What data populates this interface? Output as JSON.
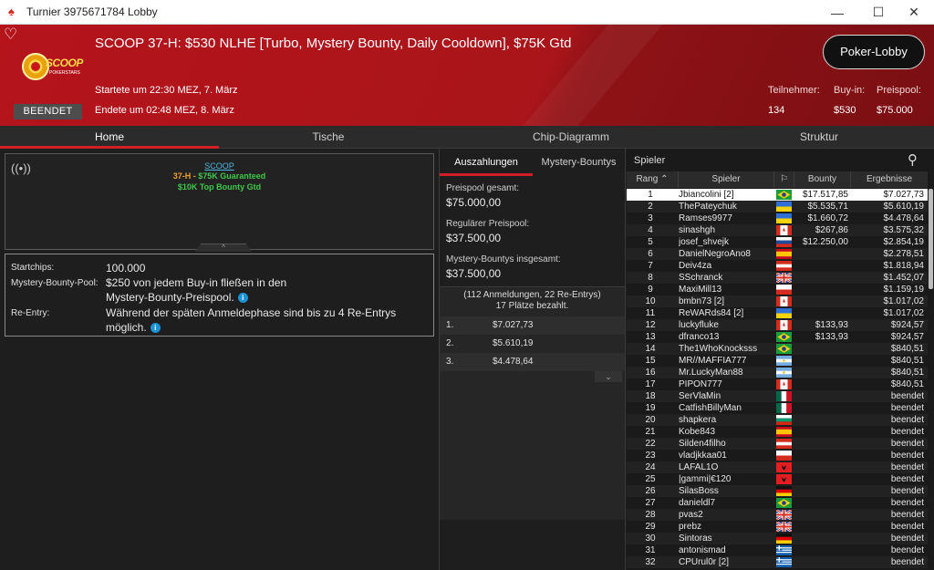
{
  "window": {
    "title": "Turnier 3975671784 Lobby",
    "minimize": "—",
    "maximize": "☐",
    "close": "✕"
  },
  "header": {
    "title": "SCOOP 37-H: $530 NLHE [Turbo, Mystery Bounty, Daily Cooldown], $75K Gtd",
    "started": "Startete um 22:30 MEZ, 7. März",
    "ended": "Endete um 02:48 MEZ, 8. März",
    "status": "BEENDET",
    "logo_text": "SCOOP",
    "logo_sub": "POKERSTARS",
    "lobby_button": "Poker-Lobby",
    "stats": [
      {
        "label": "Teilnehmer:",
        "value": "134"
      },
      {
        "label": "Buy-in:",
        "value": "$530"
      },
      {
        "label": "Preispool:",
        "value": "$75.000"
      }
    ]
  },
  "tabs": [
    "Home",
    "Tische",
    "Chip-Diagramm",
    "Struktur"
  ],
  "promo": {
    "link": "SCOOP",
    "event_code": "37-H",
    "event_sep": " - ",
    "event_text": "$75K Guaranteed",
    "bounty": "$10K Top Bounty Gtd"
  },
  "info": {
    "startchips_label": "Startchips:",
    "startchips_value": "100.000",
    "pool_label": "Mystery-Bounty-Pool:",
    "pool_value_1": "$250 von jedem Buy-in fließen in den",
    "pool_value_2": "Mystery-Bounty-Preispool.",
    "reentry_label": "Re-Entry:",
    "reentry_value_1": "Während der späten Anmeldephase sind bis zu 4 Re-Entrys",
    "reentry_value_2": "möglich."
  },
  "payouts": {
    "tabs": [
      "Auszahlungen",
      "Mystery-Bountys"
    ],
    "total_label": "Preispool gesamt:",
    "total_value": "$75.000,00",
    "regular_label": "Regulärer Preispool:",
    "regular_value": "$37.500,00",
    "bounty_label": "Mystery-Bountys insgesamt:",
    "bounty_value": "$37.500,00",
    "entries_note": "(112 Anmeldungen, 22 Re-Entrys)",
    "paid_note": "17 Plätze bezahlt.",
    "rows": [
      {
        "rank": "1.",
        "amount": "$7.027,73"
      },
      {
        "rank": "2.",
        "amount": "$5.610,19"
      },
      {
        "rank": "3.",
        "amount": "$4.478,64"
      }
    ]
  },
  "players": {
    "search_label": "Spieler",
    "columns": [
      "Rang",
      "Spieler",
      "Bounty",
      "Ergebnisse"
    ],
    "rows": [
      {
        "rank": "1",
        "name": "Jbiancolini [2]",
        "flag": "br",
        "bounty": "$17.517,85",
        "result": "$7.027,73"
      },
      {
        "rank": "2",
        "name": "ThePateychuk",
        "flag": "ua",
        "bounty": "$5.535,71",
        "result": "$5.610,19"
      },
      {
        "rank": "3",
        "name": "Ramses9977",
        "flag": "ua",
        "bounty": "$1.660,72",
        "result": "$4.478,64"
      },
      {
        "rank": "4",
        "name": "sinashgh",
        "flag": "ca",
        "bounty": "$267,86",
        "result": "$3.575,32"
      },
      {
        "rank": "5",
        "name": "josef_shvejk",
        "flag": "si",
        "bounty": "$12.250,00",
        "result": "$2.854,19"
      },
      {
        "rank": "6",
        "name": "DanielNegroAno8",
        "flag": "es",
        "bounty": "",
        "result": "$2.278,51"
      },
      {
        "rank": "7",
        "name": "Deiv4za",
        "flag": "at",
        "bounty": "",
        "result": "$1.818,94"
      },
      {
        "rank": "8",
        "name": "SSchranck",
        "flag": "gb",
        "bounty": "",
        "result": "$1.452,07"
      },
      {
        "rank": "9",
        "name": "MaxiMill13",
        "flag": "pl",
        "bounty": "",
        "result": "$1.159,19"
      },
      {
        "rank": "10",
        "name": "bmbn73 [2]",
        "flag": "ca",
        "bounty": "",
        "result": "$1.017,02"
      },
      {
        "rank": "11",
        "name": "ReWARds84 [2]",
        "flag": "ua",
        "bounty": "",
        "result": "$1.017,02"
      },
      {
        "rank": "12",
        "name": "luckyfluke",
        "flag": "ca",
        "bounty": "$133,93",
        "result": "$924,57"
      },
      {
        "rank": "13",
        "name": "dfranco13",
        "flag": "br",
        "bounty": "$133,93",
        "result": "$924,57"
      },
      {
        "rank": "14",
        "name": "The1WhoKnocksss",
        "flag": "br",
        "bounty": "",
        "result": "$840,51"
      },
      {
        "rank": "15",
        "name": "MR//MAFFIA777",
        "flag": "ar",
        "bounty": "",
        "result": "$840,51"
      },
      {
        "rank": "16",
        "name": "Mr.LuckyMan88",
        "flag": "ar",
        "bounty": "",
        "result": "$840,51"
      },
      {
        "rank": "17",
        "name": "PIPON777",
        "flag": "ca",
        "bounty": "",
        "result": "$840,51"
      },
      {
        "rank": "18",
        "name": "SerVlaMin",
        "flag": "mx",
        "bounty": "",
        "result": "beendet"
      },
      {
        "rank": "19",
        "name": "CatfishBillyMan",
        "flag": "mx",
        "bounty": "",
        "result": "beendet"
      },
      {
        "rank": "20",
        "name": "shapkera",
        "flag": "bg",
        "bounty": "",
        "result": "beendet"
      },
      {
        "rank": "21",
        "name": "Kobe843",
        "flag": "es",
        "bounty": "",
        "result": "beendet"
      },
      {
        "rank": "22",
        "name": "Silden4filho",
        "flag": "at",
        "bounty": "",
        "result": "beendet"
      },
      {
        "rank": "23",
        "name": "vladjkkaa01",
        "flag": "pl",
        "bounty": "",
        "result": "beendet"
      },
      {
        "rank": "24",
        "name": "LAFAL1O",
        "flag": "al",
        "bounty": "",
        "result": "beendet"
      },
      {
        "rank": "25",
        "name": "|gammi|€120",
        "flag": "al",
        "bounty": "",
        "result": "beendet"
      },
      {
        "rank": "26",
        "name": "SilasBoss",
        "flag": "de",
        "bounty": "",
        "result": "beendet"
      },
      {
        "rank": "27",
        "name": "danieldl7",
        "flag": "br",
        "bounty": "",
        "result": "beendet"
      },
      {
        "rank": "28",
        "name": "pvas2",
        "flag": "gb",
        "bounty": "",
        "result": "beendet"
      },
      {
        "rank": "29",
        "name": "prebz",
        "flag": "gb",
        "bounty": "",
        "result": "beendet"
      },
      {
        "rank": "30",
        "name": "Sintoras",
        "flag": "de",
        "bounty": "",
        "result": "beendet"
      },
      {
        "rank": "31",
        "name": "antonismad",
        "flag": "gr",
        "bounty": "",
        "result": "beendet"
      },
      {
        "rank": "32",
        "name": "CPUrul0r [2]",
        "flag": "gr",
        "bounty": "",
        "result": "beendet"
      }
    ]
  },
  "colors": {
    "accent": "#d11f27",
    "header": "#b5141b",
    "link": "#4fb6e0",
    "green": "#3fc84a",
    "orange": "#f0a030"
  }
}
